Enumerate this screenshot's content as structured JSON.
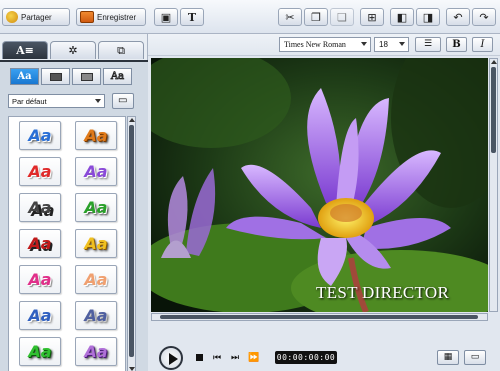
{
  "toolbar": {
    "share_label": "Partager",
    "save_label": "Enregistrer",
    "icons": [
      "share-icon",
      "save-icon",
      "image-text-icon",
      "text-tool-icon",
      "cut-icon",
      "copy-icon",
      "paste-icon",
      "layout-icon",
      "bring-forward-icon",
      "send-backward-icon",
      "undo-icon",
      "redo-icon"
    ]
  },
  "format": {
    "font": "Times New Roman",
    "size": "18",
    "bold_label": "B",
    "italic_label": "I"
  },
  "panel": {
    "tabs": [
      "text-tab-icon",
      "effects-tab-icon",
      "shapes-tab-icon"
    ],
    "subtabs": {
      "text_label": "Aa",
      "outline_label": "Aa"
    },
    "preset": "Par défaut",
    "styles": [
      {
        "label": "Aa",
        "color": "#2a6fd6"
      },
      {
        "label": "Aa",
        "color": "#e07a1a"
      },
      {
        "label": "Aa",
        "color": "#e02a2a"
      },
      {
        "label": "Aa",
        "color": "#8a4ad8"
      },
      {
        "label": "Aa",
        "color": "#444444"
      },
      {
        "label": "Aa",
        "color": "#2aa02a"
      },
      {
        "label": "Aa",
        "color": "#c01a1a"
      },
      {
        "label": "Aa",
        "color": "#f0c020"
      },
      {
        "label": "Aa",
        "color": "#e0308a"
      },
      {
        "label": "Aa",
        "color": "#f0a070"
      },
      {
        "label": "Aa",
        "color": "#3060c0"
      },
      {
        "label": "Aa",
        "color": "#5060a0"
      },
      {
        "label": "Aa",
        "color": "#30c030"
      },
      {
        "label": "Aa",
        "color": "#b070d8"
      }
    ]
  },
  "preview": {
    "caption": "TEST DIRECTOR"
  },
  "transport": {
    "timecode": "00:00:00:00"
  },
  "colors": {
    "accent": "#1877d1",
    "dark": "#2c333d"
  }
}
